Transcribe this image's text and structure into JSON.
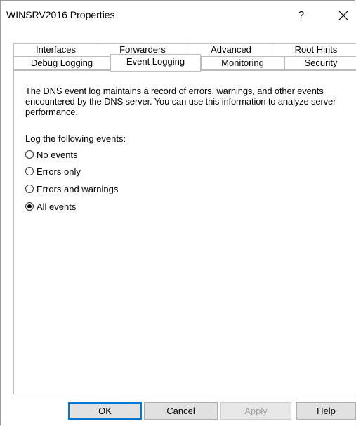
{
  "window": {
    "title": "WINSRV2016 Properties",
    "help_label": "?"
  },
  "tabs": {
    "back_row": [
      "Interfaces",
      "Forwarders",
      "Advanced",
      "Root Hints"
    ],
    "front_row": [
      "Debug Logging",
      "Event Logging",
      "Monitoring",
      "Security"
    ],
    "active": "Event Logging"
  },
  "content": {
    "description": "The DNS event log maintains a record of errors, warnings, and other events encountered by the DNS server. You can use this information to analyze server performance.",
    "log_label": "Log the following events:",
    "options": [
      {
        "label": "No events",
        "checked": false
      },
      {
        "label": "Errors only",
        "checked": false
      },
      {
        "label": "Errors and warnings",
        "checked": false
      },
      {
        "label": "All events",
        "checked": true
      }
    ]
  },
  "buttons": {
    "ok": "OK",
    "cancel": "Cancel",
    "apply": "Apply",
    "help": "Help"
  },
  "colors": {
    "default_button_border": "#0078d7",
    "button_face": "#e1e1e1",
    "disabled_text": "#a0a0a0"
  }
}
